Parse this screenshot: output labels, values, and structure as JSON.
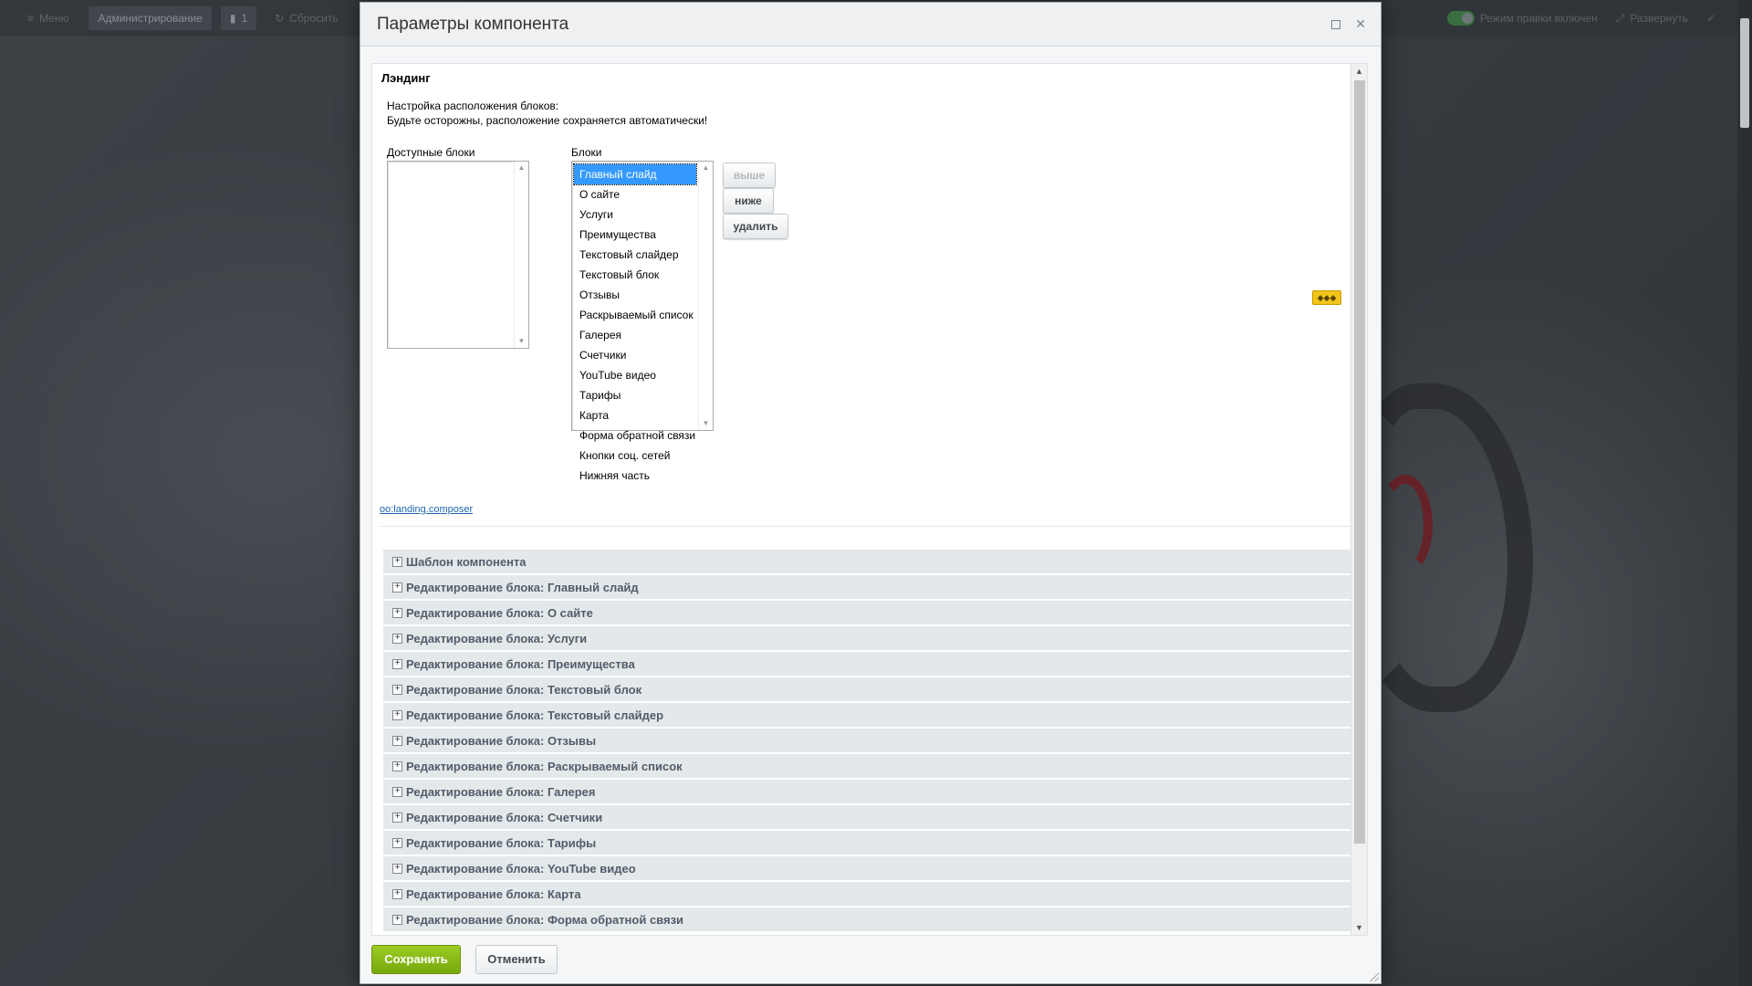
{
  "topbar": {
    "menu_label": "Меню",
    "admin_label": "Администрирование",
    "comments_count": "1",
    "reset_label": "Сбросить",
    "edit_mode_label": "Режим правки включен",
    "expand_label": "Развернуть"
  },
  "dialog": {
    "title": "Параметры компонента",
    "section_title": "Лэндинг",
    "note_line1": "Настройка расположения блоков:",
    "note_line2": "Будьте осторожны, расположение сохраняется автоматически!",
    "available_label": "Доступные блоки",
    "blocks_label": "Блоки",
    "blocks": [
      "Главный слайд",
      "О сайте",
      "Услуги",
      "Преимущества",
      "Текстовый слайдер",
      "Текстовый блок",
      "Отзывы",
      "Раскрываемый список",
      "Галерея",
      "Счетчики",
      "YouTube видео",
      "Тарифы",
      "Карта",
      "Форма обратной связи",
      "Кнопки соц. сетей",
      "Нижняя часть"
    ],
    "selected_block": "Главный слайд",
    "move_button": ">",
    "up_button": "выше",
    "down_button": "ниже",
    "delete_button": "удалить",
    "component_link": "oo:landing.composer",
    "groups": [
      "Шаблон компонента",
      "Редактирование блока: Главный слайд",
      "Редактирование блока: О сайте",
      "Редактирование блока: Услуги",
      "Редактирование блока: Преимущества",
      "Редактирование блока: Текстовый блок",
      "Редактирование блока: Текстовый слайдер",
      "Редактирование блока: Отзывы",
      "Редактирование блока: Раскрываемый список",
      "Редактирование блока: Галерея",
      "Редактирование блока: Счетчики",
      "Редактирование блока: Тарифы",
      "Редактирование блока: YouTube видео",
      "Редактирование блока: Карта",
      "Редактирование блока: Форма обратной связи"
    ],
    "save_button": "Сохранить",
    "cancel_button": "Отменить"
  },
  "colors": {
    "save_green": "#86b817",
    "selection_blue": "#3399ff",
    "group_bg": "#e3e8ea"
  }
}
